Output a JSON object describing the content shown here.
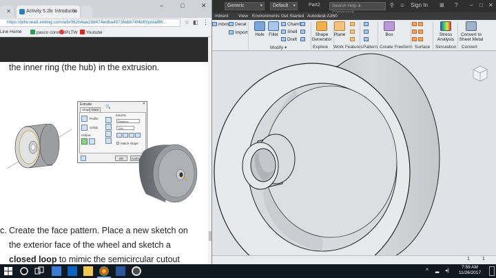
{
  "inventor": {
    "title_dropdown_1": "Generic",
    "title_dropdown_2": "Default",
    "document_title": "Part2",
    "search_placeholder": "Search Help & Commands...",
    "sign_in": "Sign In",
    "tabs": [
      "mbient",
      "View",
      "Environments",
      "Get Started",
      "Autodesk A360"
    ],
    "ribbon": {
      "emboss": "mboss",
      "decal": "Decal",
      "import": "Import",
      "hole": "Hole",
      "fillet": "Fillet",
      "chamfer": "Chamfer",
      "shell": "Shell",
      "draft": "Draft",
      "shape_generator_1": "Shape",
      "shape_generator_2": "Generator",
      "plane": "Plane",
      "box": "Box",
      "stress_1": "Stress",
      "stress_2": "Analysis",
      "convert_1": "Convert to",
      "convert_2": "Sheet Metal",
      "groups": {
        "modify": "Modify ▾",
        "explore": "Explore",
        "work_features": "Work Features",
        "pattern": "Pattern",
        "create_freeform": "Create Freeform",
        "surface": "Surface",
        "simulation": "Simulation",
        "convert": "Convert"
      }
    },
    "status_page_1": "1",
    "status_page_2": "1"
  },
  "chrome": {
    "tab1_label": "Activity 5.2b: Introductio",
    "url": "https://pltw.read.inkling.com/a/b/062b4aa29d474edba4573febb74f4bf0/p/da8f6...",
    "bookmarks": [
      "Line Home",
      "pasco connect",
      "PLTW",
      "Youtube"
    ],
    "content": {
      "line1": "the inner ring (the hub) in the extrusion.",
      "line2_prefix": "c.",
      "line2": "Create the face pattern. Place a new sketch on",
      "line3": "the exterior face of the wheel and sketch a",
      "line4_bold": "closed loop",
      "line4_rest": " to mimic the semicircular cutout"
    },
    "dialog": {
      "title": "Extrude",
      "tab_shape": "Shape",
      "tab_more": "More",
      "profile": "Profile",
      "solids": "Solids",
      "output": "Output",
      "extents": "Extents",
      "distance": "Distance",
      "value": ".250",
      "match_shape": "Match shape",
      "ok": "OK",
      "cancel": "Cancel"
    }
  },
  "taskbar": {
    "time": "7:59 AM",
    "date": "11/26/2017"
  },
  "colors": {
    "inventor_titlebar": "#2f2f2f",
    "part_face": "#e6e6e6",
    "chrome_link": "#1e6aa8"
  }
}
